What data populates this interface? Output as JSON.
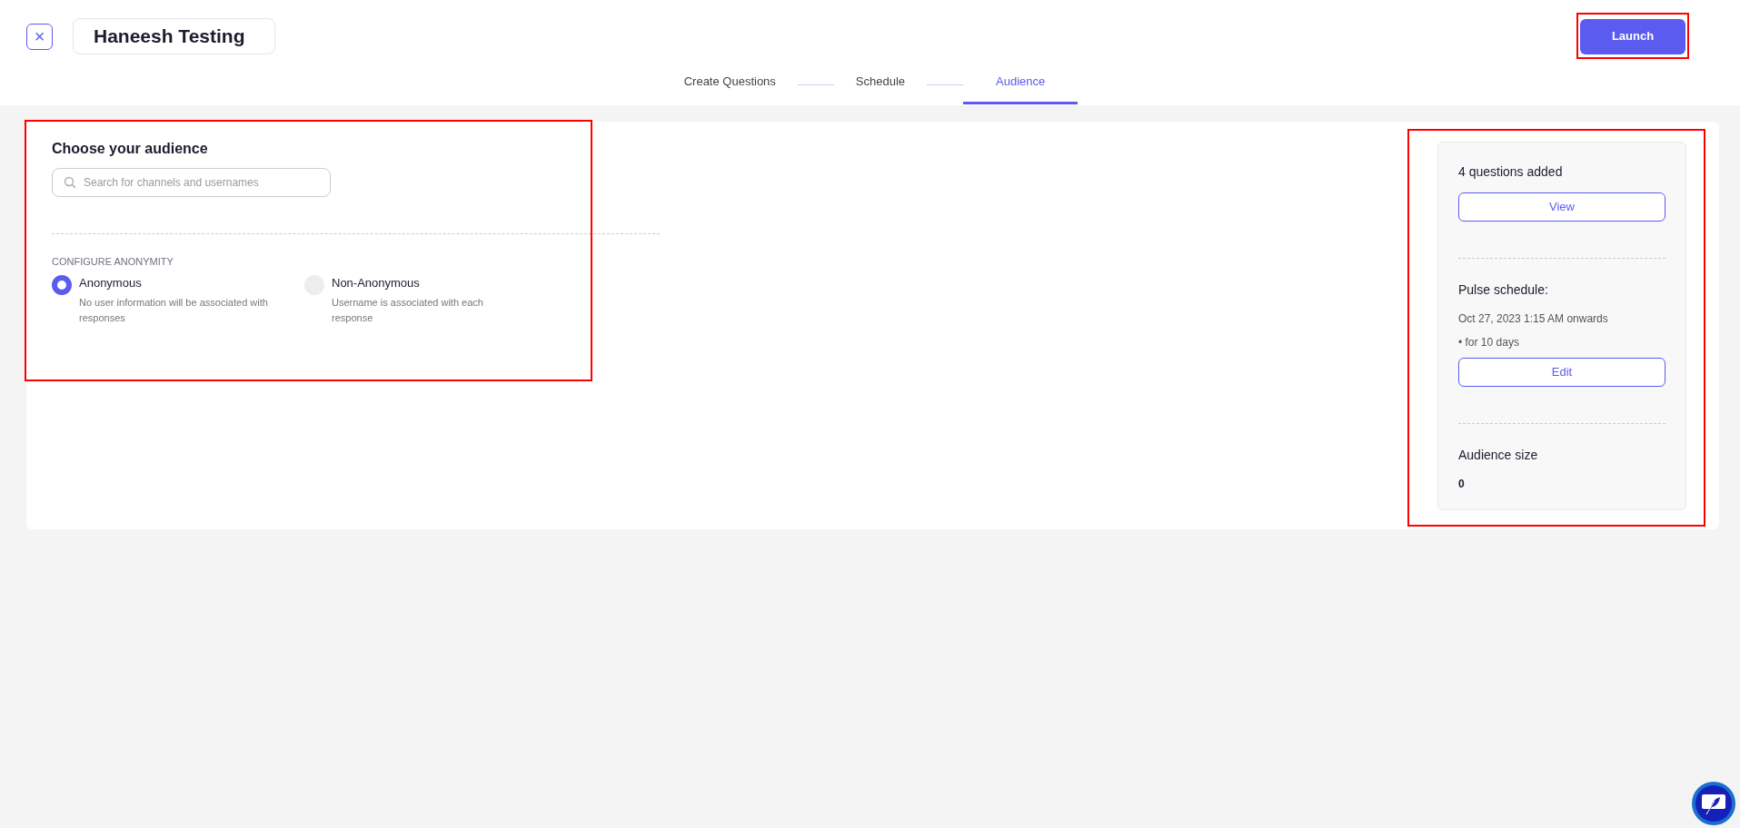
{
  "header": {
    "close_label": "×",
    "title": "Haneesh Testing",
    "launch": {
      "label": "Launch",
      "highlighted": true
    }
  },
  "steps": [
    {
      "label": "Create Questions",
      "selected": false
    },
    {
      "label": "Schedule",
      "selected": false
    },
    {
      "label": "Audience",
      "selected": true
    }
  ],
  "audience": {
    "highlighted": true,
    "heading": "Choose your audience",
    "search": {
      "placeholder": "Search for channels and usernames"
    },
    "anonymity_heading": "CONFIGURE ANONYMITY",
    "options": [
      {
        "label": "Anonymous",
        "description": "No user information will be associated with responses",
        "selected": true
      },
      {
        "label": "Non-Anonymous",
        "description": "Username is associated with each response",
        "selected": false
      }
    ]
  },
  "summary": {
    "highlighted": true,
    "questions": "4 questions added",
    "view_button": "View",
    "schedule_heading": "Pulse schedule:",
    "schedule_start": "Oct 27, 2023 1:15 AM onwards",
    "schedule_duration": "• for 10 days",
    "edit_button": "Edit",
    "audience_heading": "Audience size",
    "audience_size": "0"
  }
}
